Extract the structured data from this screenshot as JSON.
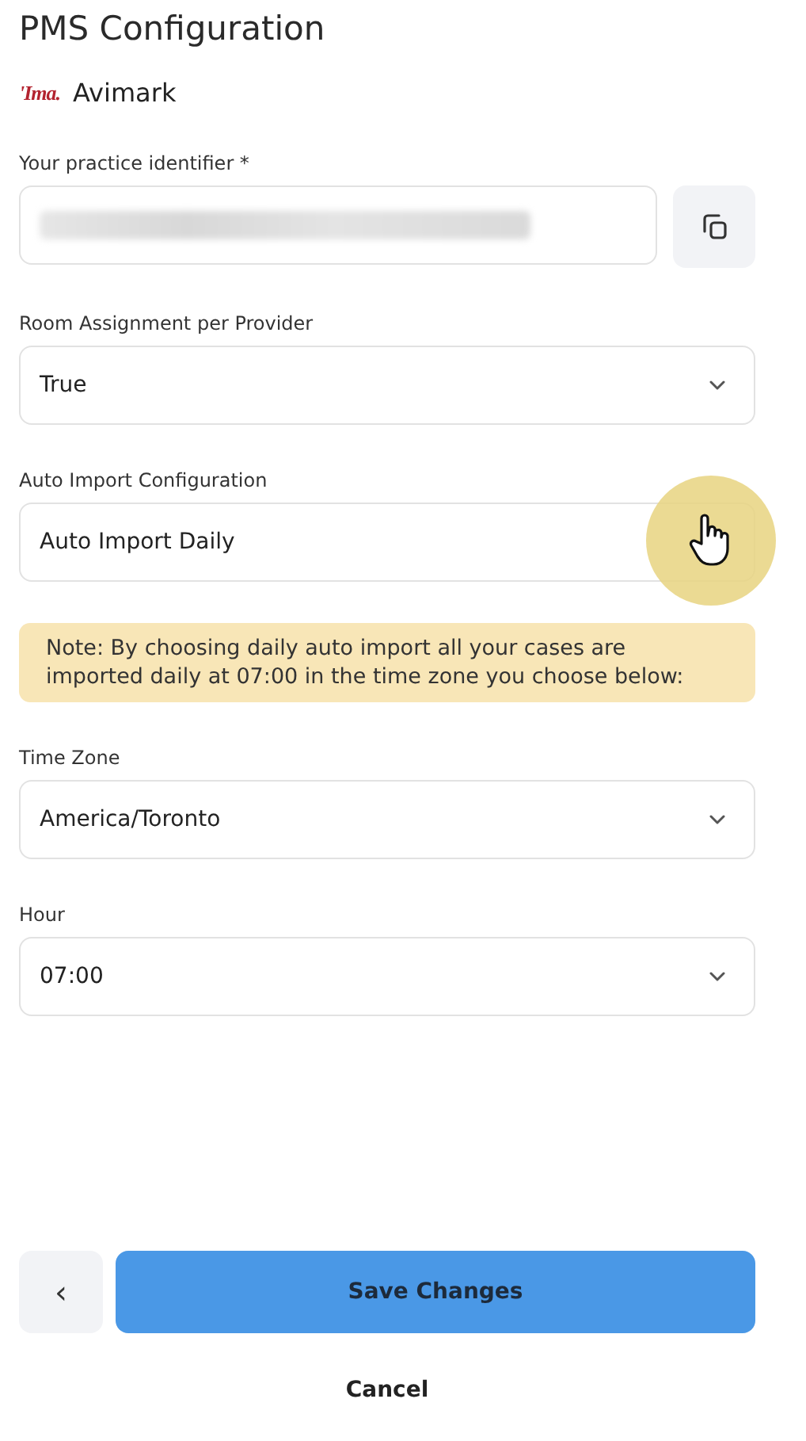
{
  "title": "PMS Configuration",
  "pms": {
    "logo_text": "'Ima.",
    "name": "Avimark"
  },
  "fields": [
    {
      "kind": "masked",
      "label": "Your practice identifier *"
    },
    {
      "kind": "select",
      "label": "Room Assignment per Provider",
      "value": "True"
    },
    {
      "kind": "select",
      "label": "Auto Import Configuration",
      "value": "Auto Import Daily",
      "pointer": true
    },
    {
      "kind": "note",
      "text": "Note: By choosing daily auto import all your cases are imported daily at 07:00 in the time zone you choose below:"
    },
    {
      "kind": "select",
      "label": "Time Zone",
      "value": "America/Toronto"
    },
    {
      "kind": "select",
      "label": "Hour",
      "value": "07:00"
    }
  ],
  "footer": {
    "back": "‹",
    "save": "Save Changes",
    "cancel": "Cancel"
  }
}
